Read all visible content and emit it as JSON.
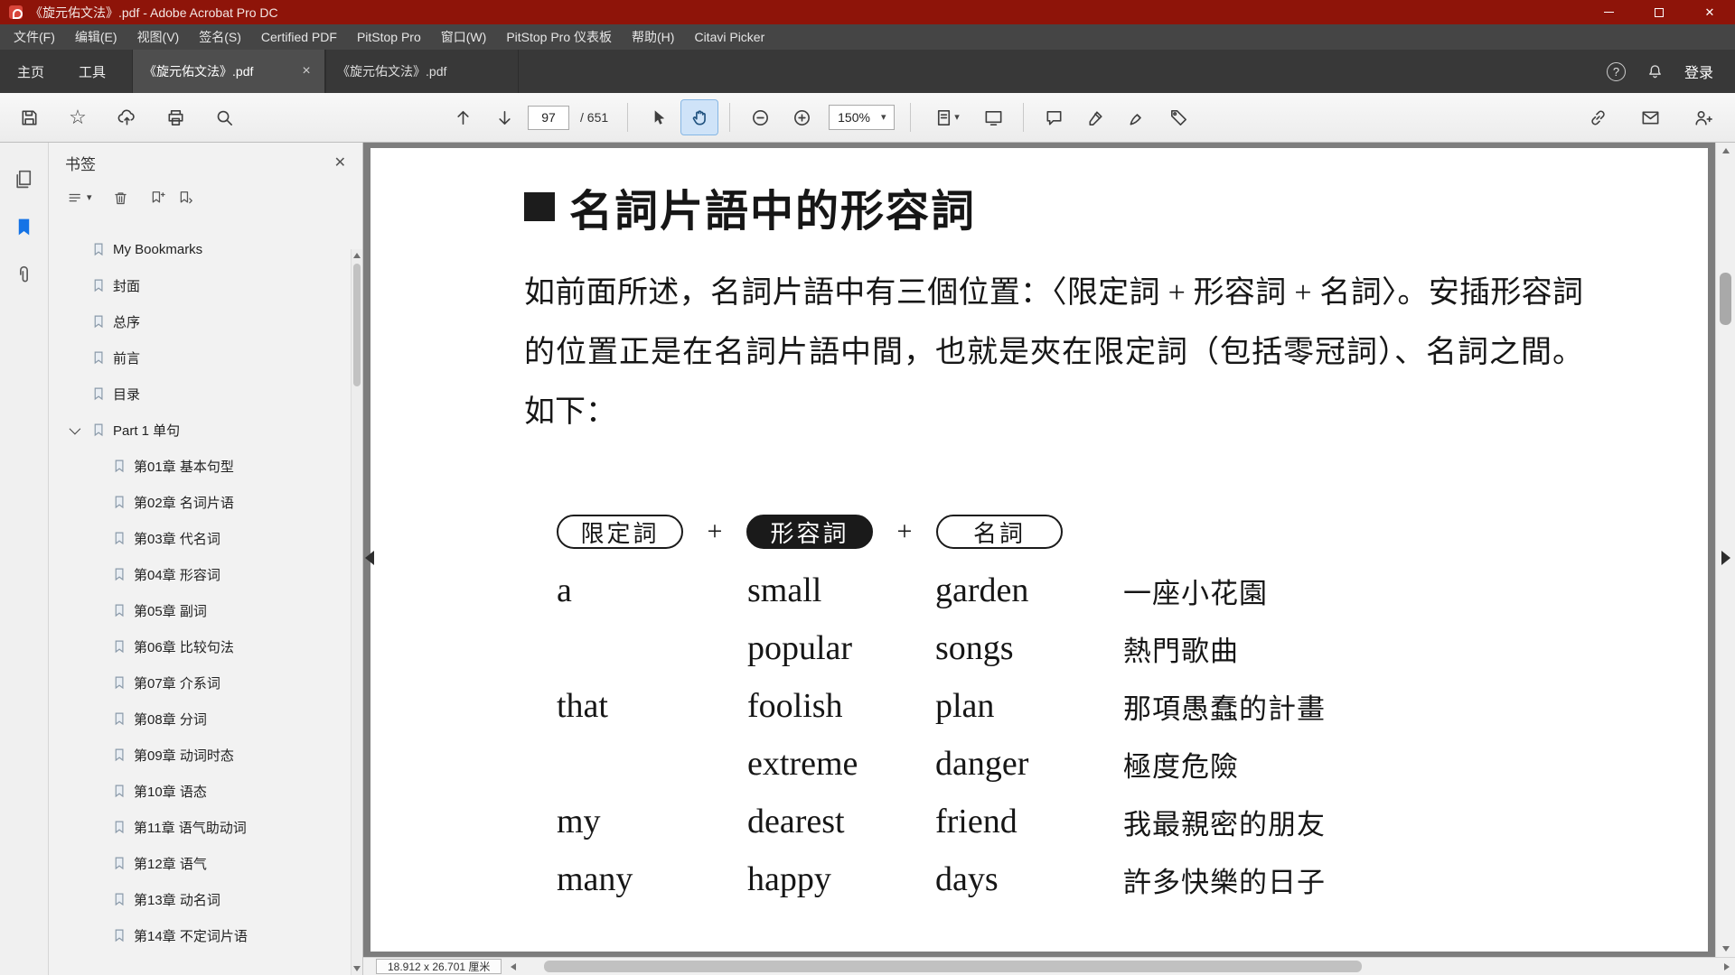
{
  "colors": {
    "titlebar_red": "#8e1409",
    "menubar_bg": "#454545",
    "navbar_bg": "#383838",
    "tab_active": "#4e4e4e",
    "panel_bg": "#f2f2f2",
    "doc_bg": "#7d7d7d",
    "hand_active_bg": "#cfe3f8",
    "bookmark_blue": "#1473e6"
  },
  "icons": {
    "close": "✕",
    "star": "☆",
    "help": "?",
    "caret": "▾"
  },
  "titlebar": {
    "title": "《旋元佑文法》.pdf - Adobe Acrobat Pro DC"
  },
  "menubar": {
    "items": [
      "文件(F)",
      "编辑(E)",
      "视图(V)",
      "签名(S)",
      "Certified PDF",
      "PitStop Pro",
      "窗口(W)",
      "PitStop Pro 仪表板",
      "帮助(H)",
      "Citavi Picker"
    ]
  },
  "navbar": {
    "home_tab": "主页",
    "tools_tab": "工具",
    "doc_tabs": [
      {
        "label": "《旋元佑文法》.pdf",
        "active": true,
        "close": "×"
      },
      {
        "label": "《旋元佑文法》.pdf",
        "active": false
      }
    ],
    "sign_in": "登录"
  },
  "toolbar": {
    "page_current": "97",
    "page_total": "/ 651",
    "zoom_level": "150%"
  },
  "sidebar": {
    "panel_title": "书签",
    "bookmarks": [
      {
        "label": "My Bookmarks",
        "level": 0
      },
      {
        "label": "封面",
        "level": 0
      },
      {
        "label": "总序",
        "level": 0
      },
      {
        "label": "前言",
        "level": 0
      },
      {
        "label": "目录",
        "level": 0
      },
      {
        "label": "Part 1 单句",
        "level": 0,
        "expanded": true
      },
      {
        "label": "第01章 基本句型",
        "level": 1
      },
      {
        "label": "第02章 名词片语",
        "level": 1
      },
      {
        "label": "第03章 代名词",
        "level": 1
      },
      {
        "label": "第04章 形容词",
        "level": 1
      },
      {
        "label": "第05章 副词",
        "level": 1
      },
      {
        "label": "第06章 比较句法",
        "level": 1
      },
      {
        "label": "第07章 介系词",
        "level": 1
      },
      {
        "label": "第08章 分词",
        "level": 1
      },
      {
        "label": "第09章 动词时态",
        "level": 1
      },
      {
        "label": "第10章 语态",
        "level": 1
      },
      {
        "label": "第11章 语气助动词",
        "level": 1
      },
      {
        "label": "第12章 语气",
        "level": 1
      },
      {
        "label": "第13章 动名词",
        "level": 1
      },
      {
        "label": "第14章 不定词片语",
        "level": 1
      }
    ]
  },
  "document": {
    "heading": "名詞片語中的形容詞",
    "paragraph": "如前面所述，名詞片語中有三個位置：〈限定詞 + 形容詞 + 名詞〉。安插形容詞的位置正是在名詞片語中間，也就是夾在限定詞（包括零冠詞）、名詞之間。如下：",
    "table": {
      "plus": "+",
      "headers": [
        {
          "label": "限定詞",
          "filled": false
        },
        {
          "label": "形容詞",
          "filled": true
        },
        {
          "label": "名詞",
          "filled": false
        }
      ],
      "rows": [
        {
          "det": "a",
          "adj": "small",
          "noun": "garden",
          "zh": "一座小花園"
        },
        {
          "det": "",
          "adj": "popular",
          "noun": "songs",
          "zh": "熱門歌曲"
        },
        {
          "det": "that",
          "adj": "foolish",
          "noun": "plan",
          "zh": "那項愚蠢的計畫"
        },
        {
          "det": "",
          "adj": "extreme",
          "noun": "danger",
          "zh": "極度危險"
        },
        {
          "det": "my",
          "adj": "dearest",
          "noun": "friend",
          "zh": "我最親密的朋友"
        },
        {
          "det": "many",
          "adj": "happy",
          "noun": "days",
          "zh": "許多快樂的日子"
        }
      ]
    }
  },
  "statusbar": {
    "page_dimensions": "18.912 x 26.701 厘米"
  }
}
